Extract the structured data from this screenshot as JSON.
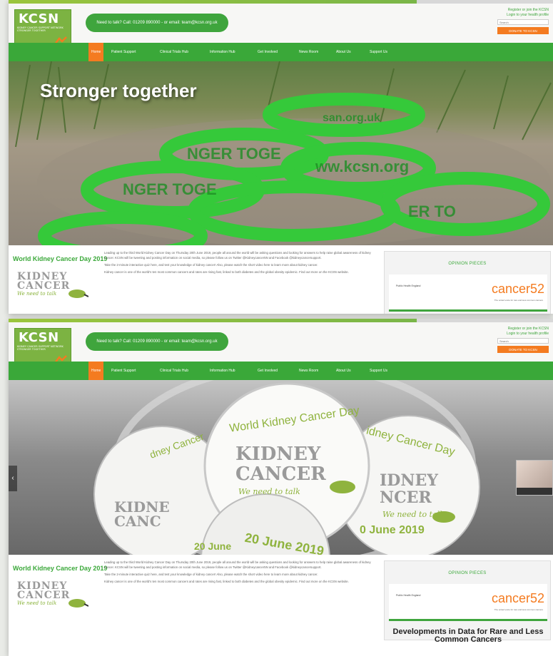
{
  "site": {
    "logo_text": "KCSN",
    "logo_sub": "KIDNEY CANCER SUPPORT NETWORK",
    "logo_tagline": "STRONGER TOGETHER",
    "contact": "Need to talk? Call: 01209 890000 - or email: team@kcsn.org.uk",
    "register": "Register or join the KCSN",
    "login": "Login to your health profile",
    "search_placeholder": "Search",
    "donate": "DONATE TO KCSN"
  },
  "nav": [
    "Home",
    "Patient Support",
    "Clinical Trials Hub",
    "Information Hub",
    "Get Involved",
    "News Room",
    "About Us",
    "Support Us"
  ],
  "slides": {
    "first_title": "Stronger together",
    "bracelet_text": "KCSN.ORG.UK · STRONGER TOGETHER · WWW.KCSN.ORG",
    "badge_text": "World Kidney Cancer Day",
    "badge_kidney": "KIDNEY",
    "badge_cancer": "CANCER",
    "badge_tag": "We need to talk",
    "badge_date": "20 June 2019"
  },
  "article": {
    "title": "World Kidney Cancer Day 2019",
    "p1": "Leading up to the third World Kidney Cancer Day on Thursday 20th June 2019, people all around the world will be asking questions and looking for answers to help raise global awareness of kidney cancer. KCSN will be tweeting and posting information on social media, so please follow us on Twitter @Kidneycancer5N and Facebook @kidneycancersupport.",
    "p2": "Take the 2-minute interactive quiz here, and test your knowledge of kidney cancer! Also, please watch the short video here to learn more about kidney cancer.",
    "p3": "Kidney cancer is one of the world's ten most common cancers and rates are rising fast, linked to both diabetes and the global obesity epidemic. Find out more on the KCSN website."
  },
  "kidney_logo": {
    "line1": "KIDNEY",
    "line2": "CANCER",
    "tag": "We need to talk"
  },
  "opinion": {
    "heading": "OPINION PIECES",
    "nhs": "Public Health England",
    "partner": "cancer52",
    "partner_sub": "The united voice for rare and less common cancers",
    "title": "Developments in Data for Rare and Less Common Cancers"
  },
  "colors": {
    "brand_green": "#3aa839",
    "accent_orange": "#f47b20"
  }
}
